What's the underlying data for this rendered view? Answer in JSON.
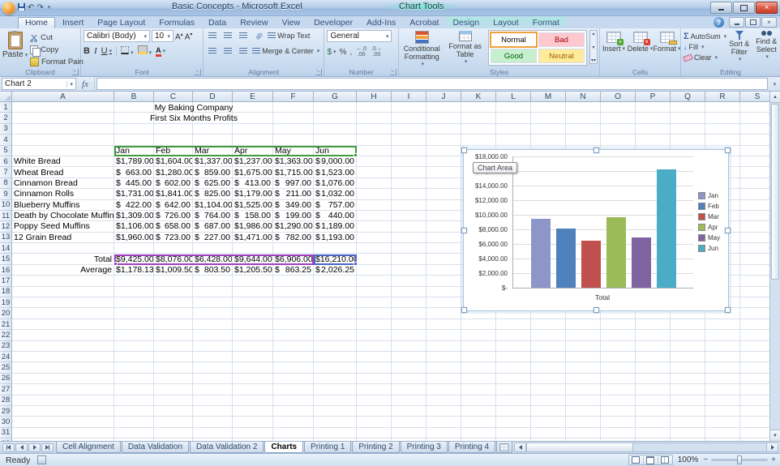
{
  "window": {
    "title": "Basic Concepts - Microsoft Excel",
    "contextual_title": "Chart Tools",
    "help": "?"
  },
  "ribbon": {
    "tabs": [
      "Home",
      "Insert",
      "Page Layout",
      "Formulas",
      "Data",
      "Review",
      "View",
      "Developer",
      "Add-Ins",
      "Acrobat"
    ],
    "active_tab": "Home",
    "contextual_tabs": [
      "Design",
      "Layout",
      "Format"
    ],
    "clipboard": {
      "group": "Clipboard",
      "paste": "Paste",
      "cut": "Cut",
      "copy": "Copy",
      "format_painter": "Format Pain"
    },
    "font": {
      "group": "Font",
      "family": "Calibri (Body)",
      "size": "10",
      "bold": "B",
      "italic": "I",
      "underline": "U"
    },
    "alignment": {
      "group": "Alignment",
      "wrap_text": "Wrap Text",
      "merge_center": "Merge & Center"
    },
    "number": {
      "group": "Number",
      "format": "General"
    },
    "styles": {
      "group": "Styles",
      "conditional": "Conditional Formatting",
      "format_table": "Format as Table",
      "gallery": [
        {
          "label": "Normal",
          "bg": "#ffffff",
          "fg": "#000000"
        },
        {
          "label": "Bad",
          "bg": "#ffc7ce",
          "fg": "#9c0006"
        },
        {
          "label": "Good",
          "bg": "#c6efce",
          "fg": "#006100"
        },
        {
          "label": "Neutral",
          "bg": "#ffeb9c",
          "fg": "#9c6500"
        }
      ]
    },
    "cells": {
      "group": "Cells",
      "insert": "Insert",
      "delete": "Delete",
      "format": "Format"
    },
    "editing": {
      "group": "Editing",
      "autosum": "AutoSum",
      "fill": "Fill",
      "clear": "Clear",
      "sort": "Sort & Filter",
      "find": "Find & Select"
    }
  },
  "formula_bar": {
    "name_box": "Chart 2",
    "fx": "fx",
    "value": ""
  },
  "grid": {
    "columns": [
      "A",
      "B",
      "C",
      "D",
      "E",
      "F",
      "G",
      "H",
      "I",
      "J",
      "K",
      "L",
      "M",
      "N",
      "O",
      "P",
      "Q",
      "R",
      "S"
    ],
    "row_count": 32
  },
  "sheet": {
    "currency": "$",
    "title1": "My Baking Company",
    "title2": "First Six Months Profits",
    "months": [
      "Jan",
      "Feb",
      "Mar",
      "Apr",
      "May",
      "Jun"
    ],
    "products": [
      {
        "name": "White Bread",
        "values": [
          "1,789.00",
          "1,604.00",
          "1,337.00",
          "1,237.00",
          "1,363.00",
          "9,000.00"
        ]
      },
      {
        "name": "Wheat Bread",
        "values": [
          "663.00",
          "1,280.00",
          "859.00",
          "1,675.00",
          "1,715.00",
          "1,523.00"
        ]
      },
      {
        "name": "Cinnamon Bread",
        "values": [
          "445.00",
          "602.00",
          "625.00",
          "413.00",
          "997.00",
          "1,076.00"
        ]
      },
      {
        "name": "Cinnamon Rolls",
        "values": [
          "1,731.00",
          "1,841.00",
          "825.00",
          "1,179.00",
          "211.00",
          "1,032.00"
        ]
      },
      {
        "name": "Blueberry Muffins",
        "values": [
          "422.00",
          "642.00",
          "1,104.00",
          "1,525.00",
          "349.00",
          "757.00"
        ]
      },
      {
        "name": "Death by Chocolate Muffins",
        "values": [
          "1,309.00",
          "726.00",
          "764.00",
          "158.00",
          "199.00",
          "440.00"
        ]
      },
      {
        "name": "Poppy Seed Muffins",
        "values": [
          "1,106.00",
          "658.00",
          "687.00",
          "1,986.00",
          "1,290.00",
          "1,189.00"
        ]
      },
      {
        "name": "12 Grain Bread",
        "values": [
          "1,960.00",
          "723.00",
          "227.00",
          "1,471.00",
          "782.00",
          "1,193.00"
        ]
      }
    ],
    "total_label": "Total",
    "total_values": [
      "9,425.00",
      "8,076.00",
      "6,428.00",
      "9,644.00",
      "6,906.00",
      "16,210.00"
    ],
    "average_label": "Average",
    "average_values": [
      "1,178.13",
      "1,009.50",
      "803.50",
      "1,205.50",
      "863.25",
      "2,026.25"
    ]
  },
  "chart_data": {
    "type": "bar",
    "categories": [
      "Jan",
      "Feb",
      "Mar",
      "Apr",
      "May",
      "Jun"
    ],
    "values": [
      9425,
      8076,
      6428,
      9644,
      6906,
      16210
    ],
    "series_colors": [
      "#8d96c8",
      "#4f81bd",
      "#c0504d",
      "#9bbb59",
      "#8064a2",
      "#4bacc6"
    ],
    "title": "",
    "xlabel": "Total",
    "ylabel": "",
    "ylim": [
      0,
      18000
    ],
    "y_ticks": [
      "$18,000.00",
      "$16,000.00",
      "$14,000.00",
      "$12,000.00",
      "$10,000.00",
      "$8,000.00",
      "$6,000.00",
      "$4,000.00",
      "$2,000.00",
      "$-"
    ],
    "gridlines": true,
    "legend_position": "right",
    "tooltip": "Chart Area"
  },
  "sheet_tabs": {
    "tabs": [
      "Cell Alignment",
      "Data Validation",
      "Data Validation 2",
      "Charts",
      "Printing 1",
      "Printing 2",
      "Printing 3",
      "Printing 4"
    ],
    "active": "Charts"
  },
  "status_bar": {
    "mode": "Ready",
    "zoom": "100%"
  }
}
